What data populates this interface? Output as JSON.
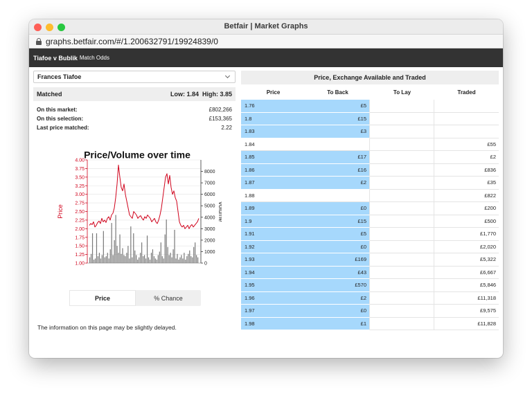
{
  "window": {
    "title": "Betfair | Market Graphs",
    "url": "graphs.betfair.com/#/1.200632791/19924839/0"
  },
  "header": {
    "event_name": "Tiafoe v Bublik",
    "market_name": "Match Odds"
  },
  "selection": {
    "value": "Frances Tiafoe"
  },
  "matched": {
    "label": "Matched",
    "low": "Low: 1.84",
    "high": "High: 3.85"
  },
  "stats": [
    {
      "label": "On this market:",
      "value": "£802,266"
    },
    {
      "label": "On this selection:",
      "value": "£153,365"
    },
    {
      "label": "Last price matched:",
      "value": "2.22"
    }
  ],
  "chart_data": {
    "type": "line",
    "title": "Price/Volume over time",
    "ylabel": "Price",
    "y2label": "Volume",
    "ylim": [
      1.0,
      4.0
    ],
    "y2lim": [
      0,
      9000
    ],
    "yticks": [
      "4.00",
      "3.75",
      "3.50",
      "3.25",
      "3.00",
      "2.75",
      "2.50",
      "2.25",
      "2.00",
      "1.75",
      "1.50",
      "1.25",
      "1.00"
    ],
    "y2ticks": [
      "8000",
      "7000",
      "6000",
      "5000",
      "4000",
      "3000",
      "2000",
      "1000",
      "0"
    ],
    "grid": true,
    "colors": {
      "price": "#d0021b",
      "volume": "#777777"
    },
    "series": [
      {
        "name": "Price",
        "values": [
          2.1,
          2.15,
          2.12,
          2.2,
          2.05,
          2.1,
          2.18,
          2.22,
          2.15,
          2.3,
          2.2,
          2.25,
          2.18,
          2.3,
          2.35,
          2.25,
          2.4,
          2.45,
          2.6,
          2.9,
          3.3,
          3.85,
          3.5,
          3.2,
          3.1,
          3.3,
          3.0,
          2.8,
          2.6,
          2.4,
          2.35,
          2.3,
          2.5,
          2.45,
          2.4,
          2.3,
          2.35,
          2.38,
          2.3,
          2.25,
          2.35,
          2.3,
          2.4,
          2.35,
          2.3,
          2.2,
          2.25,
          2.3,
          2.2,
          2.15,
          2.25,
          2.4,
          2.6,
          2.9,
          3.2,
          3.5,
          3.6,
          3.3,
          3.55,
          3.2,
          3.0,
          3.1,
          2.9,
          2.8,
          2.5,
          2.2,
          2.1,
          2.05,
          2.1,
          2.0,
          2.05,
          2.1,
          2.0,
          2.08,
          2.12,
          2.05,
          2.1,
          2.15,
          2.2,
          2.3
        ]
      },
      {
        "name": "Volume",
        "values": [
          500,
          800,
          2600,
          300,
          400,
          2600,
          600,
          900,
          400,
          700,
          2800,
          500,
          600,
          900,
          400,
          1200,
          3500,
          700,
          2000,
          4200,
          1500,
          900,
          2500,
          800,
          1300,
          700,
          600,
          900,
          1500,
          400,
          3200,
          500,
          2600,
          1100,
          700,
          300,
          500,
          900,
          1800,
          600,
          700,
          400,
          2400,
          500,
          300,
          900,
          1200,
          600,
          400,
          300,
          700,
          1000,
          1800,
          600,
          400,
          2500,
          3800,
          1400,
          700,
          900,
          500,
          1200,
          2900,
          400,
          800,
          300,
          500,
          700,
          400,
          900,
          300,
          600,
          800,
          1100,
          600,
          500,
          1400,
          1800,
          700,
          500
        ]
      }
    ]
  },
  "toggle": {
    "options": [
      "Price",
      "% Chance"
    ],
    "active": "Price"
  },
  "notice": "The information on this page may be slightly delayed.",
  "ladder": {
    "title": "Price, Exchange Available and Traded",
    "columns": [
      "Price",
      "To Back",
      "To Lay",
      "Traded"
    ],
    "rows": [
      {
        "price": "1.76",
        "back": "£5",
        "lay": "",
        "traded": "",
        "available": true
      },
      {
        "price": "1.8",
        "back": "£15",
        "lay": "",
        "traded": "",
        "available": true
      },
      {
        "price": "1.83",
        "back": "£3",
        "lay": "",
        "traded": "",
        "available": true
      },
      {
        "price": "1.84",
        "back": "",
        "lay": "",
        "traded": "£55",
        "available": false
      },
      {
        "price": "1.85",
        "back": "£17",
        "lay": "",
        "traded": "£2",
        "available": true
      },
      {
        "price": "1.86",
        "back": "£16",
        "lay": "",
        "traded": "£836",
        "available": true
      },
      {
        "price": "1.87",
        "back": "£2",
        "lay": "",
        "traded": "£35",
        "available": true
      },
      {
        "price": "1.88",
        "back": "",
        "lay": "",
        "traded": "£822",
        "available": false
      },
      {
        "price": "1.89",
        "back": "£0",
        "lay": "",
        "traded": "£200",
        "available": true
      },
      {
        "price": "1.9",
        "back": "£15",
        "lay": "",
        "traded": "£500",
        "available": true
      },
      {
        "price": "1.91",
        "back": "£5",
        "lay": "",
        "traded": "£1,770",
        "available": true
      },
      {
        "price": "1.92",
        "back": "£0",
        "lay": "",
        "traded": "£2,020",
        "available": true
      },
      {
        "price": "1.93",
        "back": "£169",
        "lay": "",
        "traded": "£5,322",
        "available": true
      },
      {
        "price": "1.94",
        "back": "£43",
        "lay": "",
        "traded": "£6,667",
        "available": true
      },
      {
        "price": "1.95",
        "back": "£570",
        "lay": "",
        "traded": "£5,846",
        "available": true
      },
      {
        "price": "1.96",
        "back": "£2",
        "lay": "",
        "traded": "£11,318",
        "available": true
      },
      {
        "price": "1.97",
        "back": "£0",
        "lay": "",
        "traded": "£9,575",
        "available": true
      },
      {
        "price": "1.98",
        "back": "£1",
        "lay": "",
        "traded": "£11,828",
        "available": true
      }
    ]
  }
}
